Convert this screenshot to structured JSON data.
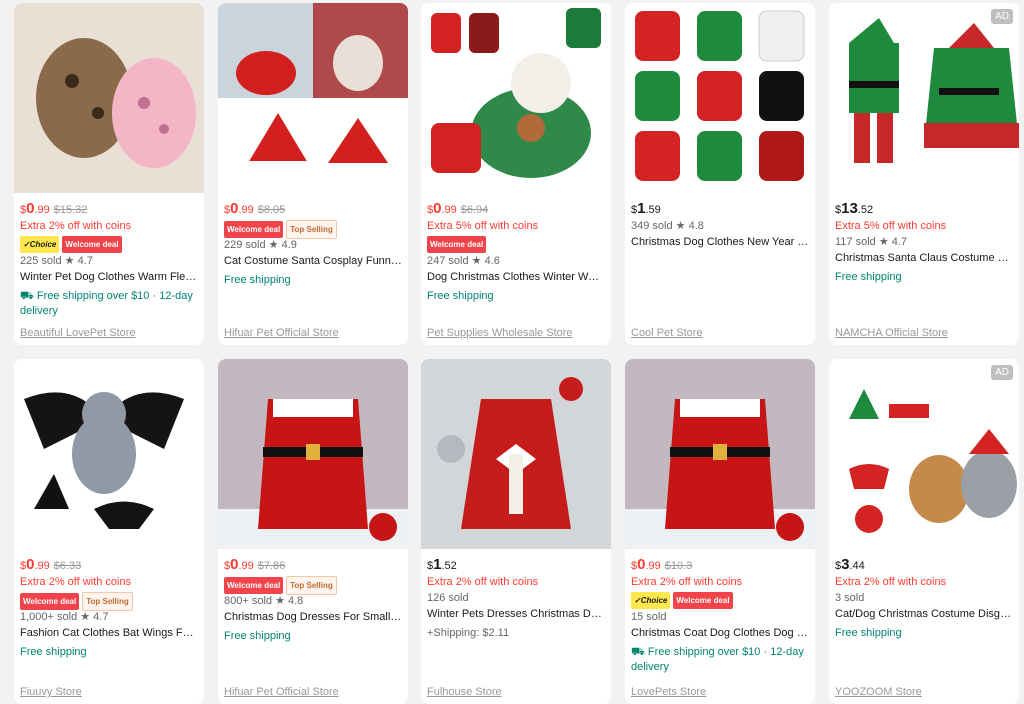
{
  "products": [
    {
      "id": "p1",
      "sale": true,
      "cur": "$",
      "int": "0",
      "dec": ".99",
      "orig": "$15.32",
      "extra": "Extra 2% off with coins",
      "tags": [
        "Choice",
        "Welcome deal"
      ],
      "sold": "225 sold",
      "rating": "4.7",
      "title": "Winter Pet Dog Clothes Warm Fleece...",
      "ship": "Free shipping over $10 · 12-day delivery",
      "ship_icon": true,
      "store": "Beautiful LovePet Store",
      "ad": false
    },
    {
      "id": "p2",
      "sale": true,
      "cur": "$",
      "int": "0",
      "dec": ".99",
      "orig": "$8.05",
      "extra": "",
      "tags": [
        "Welcome deal",
        "Top Selling"
      ],
      "sold": "229 sold",
      "rating": "4.9",
      "title": "Cat Costume Santa Cosplay Funny ...",
      "ship": "Free shipping",
      "ship_icon": false,
      "store": "Hifuar Pet Official Store",
      "ad": false
    },
    {
      "id": "p3",
      "sale": true,
      "cur": "$",
      "int": "0",
      "dec": ".99",
      "orig": "$6.94",
      "extra": "Extra 5% off with coins",
      "tags": [
        "Welcome deal"
      ],
      "sold": "247 sold",
      "rating": "4.6",
      "title": "Dog Christmas Clothes Winter War...",
      "ship": "Free shipping",
      "ship_icon": false,
      "store": "Pet Supplies Wholesale Store",
      "ad": false
    },
    {
      "id": "p4",
      "sale": false,
      "cur": "$",
      "int": "1",
      "dec": ".59",
      "orig": "",
      "extra": "",
      "tags": [],
      "sold": "349 sold",
      "rating": "4.8",
      "title": "Christmas Dog Clothes New Year P...",
      "ship": "",
      "ship_icon": false,
      "store": "Cool Pet Store",
      "ad": false
    },
    {
      "id": "p5",
      "sale": false,
      "cur": "$",
      "int": "13",
      "dec": ".52",
      "orig": "",
      "extra": "Extra 5% off with coins",
      "tags": [],
      "sold": "117 sold",
      "rating": "4.7",
      "title": "Christmas Santa Claus Costume Gr...",
      "ship": "Free shipping",
      "ship_icon": false,
      "store": "NAMCHA Official Store",
      "ad": true
    },
    {
      "id": "p6",
      "sale": true,
      "cur": "$",
      "int": "0",
      "dec": ".99",
      "orig": "$6.33",
      "extra": "Extra 2% off with coins",
      "tags": [
        "Welcome deal",
        "Top Selling"
      ],
      "sold": "1,000+ sold",
      "rating": "4.7",
      "title": "Fashion Cat Clothes Bat Wings Fun...",
      "ship": "Free shipping",
      "ship_icon": false,
      "store": "Fiuuvy Store",
      "ad": false
    },
    {
      "id": "p7",
      "sale": true,
      "cur": "$",
      "int": "0",
      "dec": ".99",
      "orig": "$7.86",
      "extra": "",
      "tags": [
        "Welcome deal",
        "Top Selling"
      ],
      "sold": "800+ sold",
      "rating": "4.8",
      "title": "Christmas Dog Dresses For Small ...",
      "ship": "Free shipping",
      "ship_icon": false,
      "store": "Hifuar Pet Official Store",
      "ad": false
    },
    {
      "id": "p8",
      "sale": false,
      "cur": "$",
      "int": "1",
      "dec": ".52",
      "orig": "",
      "extra": "Extra 2% off with coins",
      "tags": [],
      "sold": "126 sold",
      "rating": "",
      "title": "Winter Pets Dresses Christmas Do...",
      "ship": "+Shipping: $2.11",
      "ship_icon": false,
      "ship_plain": true,
      "store": "Fulhouse Store",
      "ad": false
    },
    {
      "id": "p9",
      "sale": true,
      "cur": "$",
      "int": "0",
      "dec": ".99",
      "orig": "$10.3",
      "extra": "Extra 2% off with coins",
      "tags": [
        "Choice",
        "Welcome deal"
      ],
      "sold": "15 sold",
      "rating": "",
      "title": "Christmas Coat Dog Clothes Dog D...",
      "ship": "Free shipping over $10 · 12-day delivery",
      "ship_icon": true,
      "store": "LovePets Store",
      "ad": false
    },
    {
      "id": "p10",
      "sale": false,
      "cur": "$",
      "int": "3",
      "dec": ".44",
      "orig": "",
      "extra": "Extra 2% off with coins",
      "tags": [],
      "sold": "3 sold",
      "rating": "",
      "title": "Cat/Dog Christmas Costume Disgu...",
      "ship": "Free shipping",
      "ship_icon": false,
      "store": "YOOZOOM Store",
      "ad": true
    }
  ],
  "labels": {
    "ad": "AD",
    "star": "★"
  },
  "colors": {
    "sale_price": "#ff3a31",
    "ship_green": "#00856f",
    "choice_yellow": "#ffe84d",
    "welcome_red": "#f0444a"
  }
}
